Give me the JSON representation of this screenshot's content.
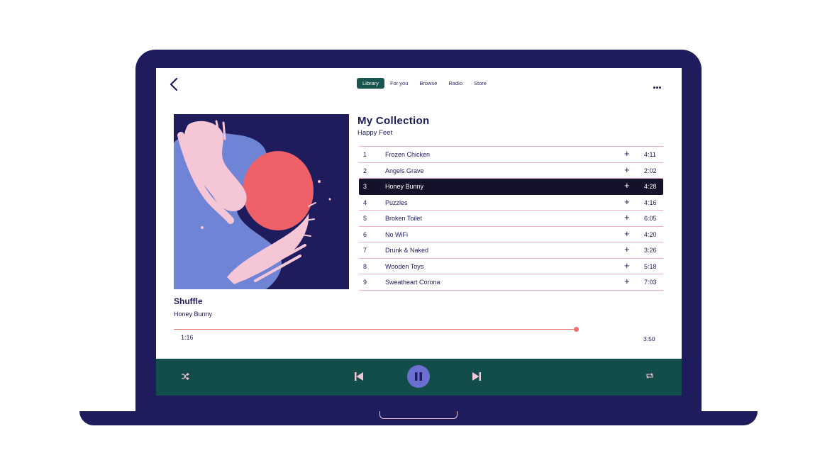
{
  "colors": {
    "bezel": "#1f1c5e",
    "accent_green": "#17554e",
    "player_bar": "#134d4a",
    "active_row": "#13122a",
    "progress": "#ef6f6f",
    "pause_button": "#6b6fcf",
    "divider": "#f0b3c3"
  },
  "header": {
    "back_icon": "chevron-left-icon",
    "tabs": [
      {
        "label": "Library",
        "active": true
      },
      {
        "label": "For you",
        "active": false
      },
      {
        "label": "Browse",
        "active": false
      },
      {
        "label": "Radio",
        "active": false
      },
      {
        "label": "Store",
        "active": false
      }
    ],
    "more_icon": "more-horizontal-icon"
  },
  "collection": {
    "title": "My Collection",
    "subtitle": "Happy Feet"
  },
  "tracks": [
    {
      "num": "1",
      "title": "Frozen Chicken",
      "duration": "4:11",
      "add": "+"
    },
    {
      "num": "2",
      "title": "Angels Grave",
      "duration": "2:02",
      "add": "+"
    },
    {
      "num": "3",
      "title": "Honey Bunny",
      "duration": "4:28",
      "add": "+",
      "active": true
    },
    {
      "num": "4",
      "title": "Puzzles",
      "duration": "4:16",
      "add": "+"
    },
    {
      "num": "5",
      "title": "Broken Toilet",
      "duration": "6:05",
      "add": "+"
    },
    {
      "num": "6",
      "title": "No WiFi",
      "duration": "4:20",
      "add": "+"
    },
    {
      "num": "7",
      "title": "Drunk & Naked",
      "duration": "3:26",
      "add": "+"
    },
    {
      "num": "8",
      "title": "Wooden Toys",
      "duration": "5:18",
      "add": "+"
    },
    {
      "num": "9",
      "title": "Sweatheart Corona",
      "duration": "7:03",
      "add": "+"
    }
  ],
  "now_playing": {
    "mode": "Shuffle",
    "track": "Honey Bunny",
    "elapsed": "1:16",
    "total": "3:50",
    "progress_fraction": 0.94
  },
  "controls": {
    "shuffle_icon": "shuffle-icon",
    "previous_icon": "skip-previous-icon",
    "pause_icon": "pause-icon",
    "next_icon": "skip-next-icon",
    "repeat_icon": "repeat-icon"
  }
}
